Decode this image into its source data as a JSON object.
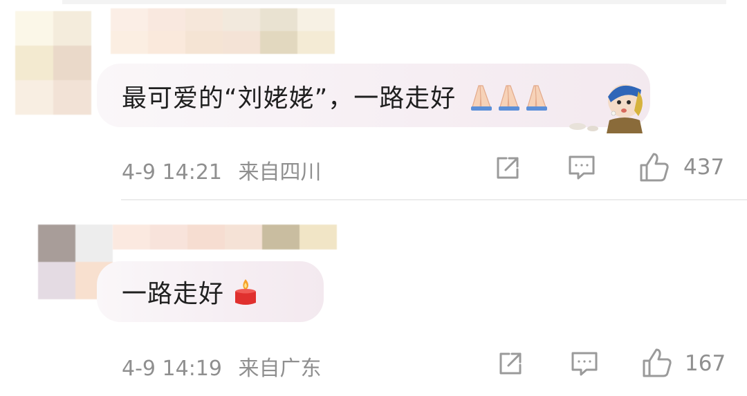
{
  "comments": [
    {
      "text": "最可爱的“刘姥姥”，一路走好",
      "emoji": "🙏🙏🙏",
      "timestamp": "4-9 14:21",
      "location": "来自四川",
      "likes": "437"
    },
    {
      "text": "一路走好",
      "emoji": "🕯",
      "timestamp": "4-9 14:19",
      "location": "来自广东",
      "likes": "167"
    }
  ],
  "icons": {
    "share": "share-icon",
    "comment": "comment-icon",
    "like": "thumbs-up-icon",
    "sticker": "girl-with-pearl-earring-sticker"
  },
  "colors": {
    "meta_text": "#8f8f8f",
    "bubble_bg": "#f6eef3",
    "main_text": "#1f1f1f"
  }
}
